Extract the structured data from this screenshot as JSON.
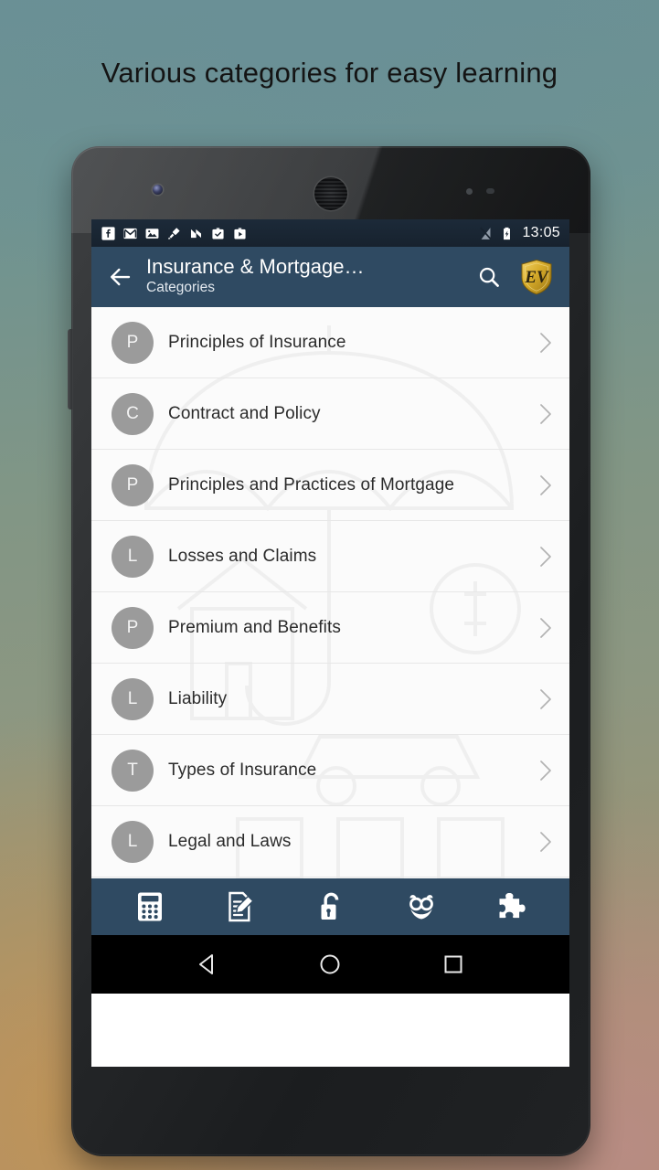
{
  "headline": "Various categories for easy learning",
  "statusbar": {
    "notification_icons": [
      "facebook-icon",
      "gmail-icon",
      "photos-icon",
      "cleaner-icon",
      "n-app-icon",
      "tasks-icon",
      "play-store-icon"
    ],
    "system_icons": [
      "signal-off-icon",
      "battery-charging-icon"
    ],
    "clock": "13:05"
  },
  "appbar": {
    "back_icon": "back-arrow-icon",
    "title": "Insurance & Mortgage…",
    "subtitle": "Categories",
    "search_icon": "search-icon",
    "logo_text": "EV",
    "logo_name": "ev-shield-logo",
    "bg_color": "#2f4a62"
  },
  "list": {
    "items": [
      {
        "initial": "P",
        "label": "Principles of Insurance"
      },
      {
        "initial": "C",
        "label": "Contract and Policy"
      },
      {
        "initial": "P",
        "label": "Principles and Practices of Mortgage"
      },
      {
        "initial": "L",
        "label": "Losses and Claims"
      },
      {
        "initial": "P",
        "label": "Premium and Benefits"
      },
      {
        "initial": "L",
        "label": "Liability"
      },
      {
        "initial": "T",
        "label": "Types of Insurance"
      },
      {
        "initial": "L",
        "label": "Legal and Laws"
      }
    ],
    "chevron_icon": "chevron-right-icon",
    "avatar_color": "#9b9b9b"
  },
  "bottombar": {
    "items": [
      {
        "icon": "calculator-icon",
        "name": "calculator"
      },
      {
        "icon": "note-edit-icon",
        "name": "notes"
      },
      {
        "icon": "unlock-icon",
        "name": "unlock"
      },
      {
        "icon": "owl-icon",
        "name": "owl"
      },
      {
        "icon": "puzzle-icon",
        "name": "puzzle"
      }
    ],
    "bg_color": "#2f4a62"
  },
  "navbar": {
    "items": [
      {
        "icon": "android-back-icon",
        "name": "back"
      },
      {
        "icon": "android-home-icon",
        "name": "home"
      },
      {
        "icon": "android-recents-icon",
        "name": "recents"
      }
    ]
  }
}
